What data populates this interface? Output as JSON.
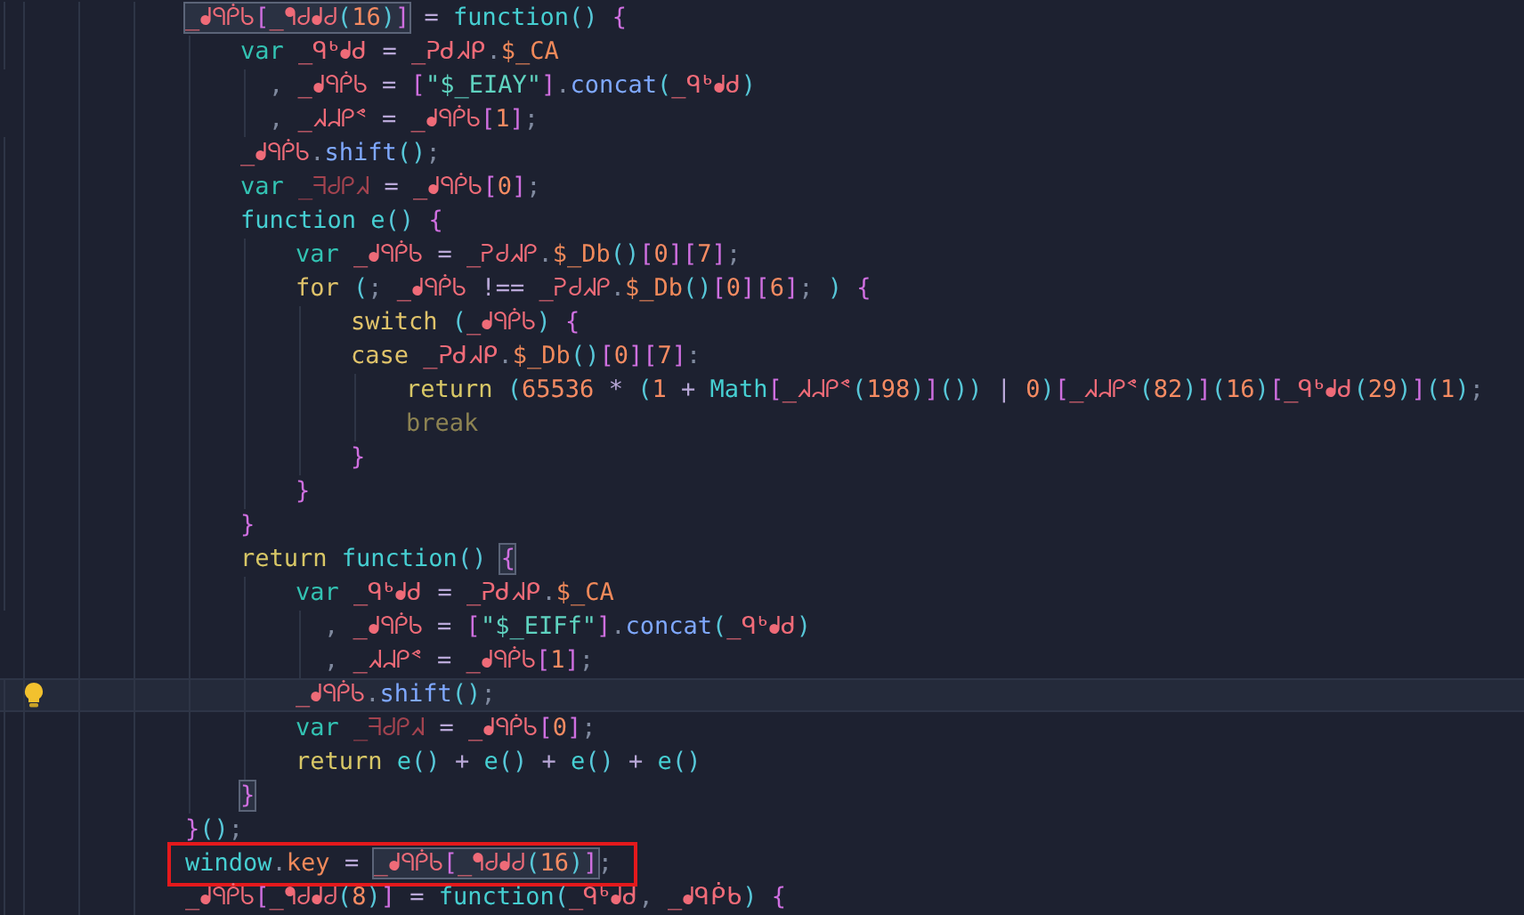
{
  "editor": {
    "lines": [
      {
        "current": false,
        "annotated": false,
        "tokens": [
          {
            "kind": "group",
            "boxed": true,
            "parts": [
              {
                "kind": "i",
                "t": "_ᖱᑫᑮᑲ"
              },
              {
                "kind": "br",
                "t": "["
              },
              {
                "kind": "i",
                "t": "_ᖳᑯᖱᑯ"
              },
              {
                "kind": "pa",
                "t": "("
              },
              {
                "kind": "n",
                "t": "16"
              },
              {
                "kind": "pa",
                "t": ")"
              },
              {
                "kind": "br",
                "t": "]"
              }
            ]
          },
          {
            "kind": "o",
            "t": " = "
          },
          {
            "kind": "f",
            "t": "function"
          },
          {
            "kind": "pa",
            "t": "() "
          },
          {
            "kind": "br",
            "t": "{"
          }
        ],
        "children": [
          {
            "current": false,
            "annotated": false,
            "tokens": [
              {
                "kind": "v",
                "t": "var "
              },
              {
                "kind": "i",
                "t": "_ᑫᒃᖱᑯ"
              },
              {
                "kind": "o",
                "t": " = "
              },
              {
                "kind": "i",
                "t": "_ᕈᑯᖽᑭ"
              },
              {
                "kind": "p",
                "t": "."
              },
              {
                "kind": "pr",
                "t": "$_CA"
              }
            ]
          },
          {
            "kind": "cont",
            "current": false,
            "annotated": false,
            "tokens": [
              {
                "kind": "p",
                "t": ", "
              },
              {
                "kind": "i",
                "t": "_ᖱᑫᑮᑲ"
              },
              {
                "kind": "o",
                "t": " = "
              },
              {
                "kind": "br",
                "t": "["
              },
              {
                "kind": "s",
                "t": "\"$_EIAY\""
              },
              {
                "kind": "br",
                "t": "]"
              },
              {
                "kind": "p",
                "t": "."
              },
              {
                "kind": "m",
                "t": "concat"
              },
              {
                "kind": "pa",
                "t": "("
              },
              {
                "kind": "i",
                "t": "_ᑫᒃᖱᑯ"
              },
              {
                "kind": "pa",
                "t": ")"
              }
            ]
          },
          {
            "kind": "cont",
            "current": false,
            "annotated": false,
            "tokens": [
              {
                "kind": "p",
                "t": ", "
              },
              {
                "kind": "i",
                "t": "_ᖽᖹᑭᕝ"
              },
              {
                "kind": "o",
                "t": " = "
              },
              {
                "kind": "i",
                "t": "_ᖱᑫᑮᑲ"
              },
              {
                "kind": "br",
                "t": "["
              },
              {
                "kind": "n",
                "t": "1"
              },
              {
                "kind": "br",
                "t": "]"
              },
              {
                "kind": "p",
                "t": ";"
              }
            ]
          },
          {
            "current": false,
            "annotated": false,
            "tokens": [
              {
                "kind": "i",
                "t": "_ᖱᑫᑮᑲ"
              },
              {
                "kind": "p",
                "t": "."
              },
              {
                "kind": "m",
                "t": "shift"
              },
              {
                "kind": "pa",
                "t": "()"
              },
              {
                "kind": "p",
                "t": ";"
              }
            ]
          },
          {
            "current": false,
            "annotated": false,
            "tokens": [
              {
                "kind": "v",
                "t": "var "
              },
              {
                "kind": "d",
                "t": "_ᖷᑯᑭᖽ"
              },
              {
                "kind": "o",
                "t": " = "
              },
              {
                "kind": "i",
                "t": "_ᖱᑫᑮᑲ"
              },
              {
                "kind": "br",
                "t": "["
              },
              {
                "kind": "n",
                "t": "0"
              },
              {
                "kind": "br",
                "t": "]"
              },
              {
                "kind": "p",
                "t": ";"
              }
            ]
          },
          {
            "current": false,
            "annotated": false,
            "tokens": [
              {
                "kind": "f",
                "t": "function "
              },
              {
                "kind": "g",
                "t": "e"
              },
              {
                "kind": "pa",
                "t": "() "
              },
              {
                "kind": "br",
                "t": "{"
              }
            ],
            "children": [
              {
                "current": false,
                "annotated": false,
                "tokens": [
                  {
                    "kind": "v",
                    "t": "var "
                  },
                  {
                    "kind": "i",
                    "t": "_ᖱᑫᑮᑲ"
                  },
                  {
                    "kind": "o",
                    "t": " = "
                  },
                  {
                    "kind": "i",
                    "t": "_ᕈᑯᖽᑭ"
                  },
                  {
                    "kind": "p",
                    "t": "."
                  },
                  {
                    "kind": "pr",
                    "t": "$_Db"
                  },
                  {
                    "kind": "pa",
                    "t": "()"
                  },
                  {
                    "kind": "br",
                    "t": "["
                  },
                  {
                    "kind": "n",
                    "t": "0"
                  },
                  {
                    "kind": "br",
                    "t": "]["
                  },
                  {
                    "kind": "n",
                    "t": "7"
                  },
                  {
                    "kind": "br",
                    "t": "]"
                  },
                  {
                    "kind": "p",
                    "t": ";"
                  }
                ]
              },
              {
                "current": false,
                "annotated": false,
                "tokens": [
                  {
                    "kind": "c",
                    "t": "for "
                  },
                  {
                    "kind": "pa",
                    "t": "("
                  },
                  {
                    "kind": "p",
                    "t": "; "
                  },
                  {
                    "kind": "i",
                    "t": "_ᖱᑫᑮᑲ"
                  },
                  {
                    "kind": "o",
                    "t": " !== "
                  },
                  {
                    "kind": "i",
                    "t": "_ᕈᑯᖽᑭ"
                  },
                  {
                    "kind": "p",
                    "t": "."
                  },
                  {
                    "kind": "pr",
                    "t": "$_Db"
                  },
                  {
                    "kind": "pa",
                    "t": "()"
                  },
                  {
                    "kind": "br",
                    "t": "["
                  },
                  {
                    "kind": "n",
                    "t": "0"
                  },
                  {
                    "kind": "br",
                    "t": "]["
                  },
                  {
                    "kind": "n",
                    "t": "6"
                  },
                  {
                    "kind": "br",
                    "t": "]"
                  },
                  {
                    "kind": "p",
                    "t": "; "
                  },
                  {
                    "kind": "pa",
                    "t": ") "
                  },
                  {
                    "kind": "br",
                    "t": "{"
                  }
                ],
                "children": [
                  {
                    "current": false,
                    "annotated": false,
                    "tokens": [
                      {
                        "kind": "c",
                        "t": "switch "
                      },
                      {
                        "kind": "pa",
                        "t": "("
                      },
                      {
                        "kind": "i",
                        "t": "_ᖱᑫᑮᑲ"
                      },
                      {
                        "kind": "pa",
                        "t": ") "
                      },
                      {
                        "kind": "br",
                        "t": "{"
                      }
                    ],
                    "children": [
                      {
                        "kind": "case",
                        "current": false,
                        "annotated": false,
                        "tokens": [
                          {
                            "kind": "c",
                            "t": "case "
                          },
                          {
                            "kind": "i",
                            "t": "_ᕈᑯᖽᑭ"
                          },
                          {
                            "kind": "p",
                            "t": "."
                          },
                          {
                            "kind": "pr",
                            "t": "$_Db"
                          },
                          {
                            "kind": "pa",
                            "t": "()"
                          },
                          {
                            "kind": "br",
                            "t": "["
                          },
                          {
                            "kind": "n",
                            "t": "0"
                          },
                          {
                            "kind": "br",
                            "t": "]["
                          },
                          {
                            "kind": "n",
                            "t": "7"
                          },
                          {
                            "kind": "br",
                            "t": "]"
                          },
                          {
                            "kind": "p",
                            "t": ":"
                          }
                        ],
                        "children": [
                          {
                            "current": false,
                            "annotated": false,
                            "tokens": [
                              {
                                "kind": "r",
                                "t": "return "
                              },
                              {
                                "kind": "pa",
                                "t": "("
                              },
                              {
                                "kind": "n",
                                "t": "65536"
                              },
                              {
                                "kind": "o",
                                "t": " * "
                              },
                              {
                                "kind": "pa",
                                "t": "("
                              },
                              {
                                "kind": "n",
                                "t": "1"
                              },
                              {
                                "kind": "o",
                                "t": " + "
                              },
                              {
                                "kind": "g",
                                "t": "Math"
                              },
                              {
                                "kind": "br",
                                "t": "["
                              },
                              {
                                "kind": "i",
                                "t": "_ᖽᖹᑭᕝ"
                              },
                              {
                                "kind": "pa",
                                "t": "("
                              },
                              {
                                "kind": "n",
                                "t": "198"
                              },
                              {
                                "kind": "pa",
                                "t": ")"
                              },
                              {
                                "kind": "br",
                                "t": "]"
                              },
                              {
                                "kind": "pa",
                                "t": "())"
                              },
                              {
                                "kind": "o",
                                "t": " | "
                              },
                              {
                                "kind": "n",
                                "t": "0"
                              },
                              {
                                "kind": "pa",
                                "t": ")"
                              },
                              {
                                "kind": "br",
                                "t": "["
                              },
                              {
                                "kind": "i",
                                "t": "_ᖽᖹᑭᕝ"
                              },
                              {
                                "kind": "pa",
                                "t": "("
                              },
                              {
                                "kind": "n",
                                "t": "82"
                              },
                              {
                                "kind": "pa",
                                "t": ")"
                              },
                              {
                                "kind": "br",
                                "t": "]"
                              },
                              {
                                "kind": "pa",
                                "t": "("
                              },
                              {
                                "kind": "n",
                                "t": "16"
                              },
                              {
                                "kind": "pa",
                                "t": ")"
                              },
                              {
                                "kind": "br",
                                "t": "["
                              },
                              {
                                "kind": "i",
                                "t": "_ᑫᒃᖱᑯ"
                              },
                              {
                                "kind": "pa",
                                "t": "("
                              },
                              {
                                "kind": "n",
                                "t": "29"
                              },
                              {
                                "kind": "pa",
                                "t": ")"
                              },
                              {
                                "kind": "br",
                                "t": "]"
                              },
                              {
                                "kind": "pa",
                                "t": "("
                              },
                              {
                                "kind": "n",
                                "t": "1"
                              },
                              {
                                "kind": "pa",
                                "t": ")"
                              },
                              {
                                "kind": "p",
                                "t": ";"
                              }
                            ]
                          },
                          {
                            "current": false,
                            "annotated": false,
                            "tokens": [
                              {
                                "kind": "b",
                                "t": "break"
                              }
                            ]
                          }
                        ]
                      }
                    ]
                  },
                  {
                    "current": false,
                    "annotated": false,
                    "tokens": [
                      {
                        "kind": "br",
                        "t": "}"
                      }
                    ]
                  }
                ]
              },
              {
                "current": false,
                "annotated": false,
                "tokens": [
                  {
                    "kind": "br",
                    "t": "}"
                  }
                ]
              }
            ]
          },
          {
            "current": false,
            "annotated": false,
            "tokens": [
              {
                "kind": "br",
                "t": "}"
              }
            ]
          },
          {
            "current": false,
            "annotated": false,
            "tokens": [
              {
                "kind": "r",
                "t": "return "
              },
              {
                "kind": "f",
                "t": "function"
              },
              {
                "kind": "pa",
                "t": "() "
              },
              {
                "kind": "group",
                "boxed": true,
                "parts": [
                  {
                    "kind": "br",
                    "t": "{"
                  }
                ]
              }
            ],
            "children": [
              {
                "current": false,
                "annotated": false,
                "tokens": [
                  {
                    "kind": "v",
                    "t": "var "
                  },
                  {
                    "kind": "i",
                    "t": "_ᑫᒃᖱᑯ"
                  },
                  {
                    "kind": "o",
                    "t": " = "
                  },
                  {
                    "kind": "i",
                    "t": "_ᕈᑯᖽᑭ"
                  },
                  {
                    "kind": "p",
                    "t": "."
                  },
                  {
                    "kind": "pr",
                    "t": "$_CA"
                  }
                ]
              },
              {
                "kind": "cont",
                "current": false,
                "annotated": false,
                "tokens": [
                  {
                    "kind": "p",
                    "t": ", "
                  },
                  {
                    "kind": "i",
                    "t": "_ᖱᑫᑮᑲ"
                  },
                  {
                    "kind": "o",
                    "t": " = "
                  },
                  {
                    "kind": "br",
                    "t": "["
                  },
                  {
                    "kind": "s",
                    "t": "\"$_EIFf\""
                  },
                  {
                    "kind": "br",
                    "t": "]"
                  },
                  {
                    "kind": "p",
                    "t": "."
                  },
                  {
                    "kind": "m",
                    "t": "concat"
                  },
                  {
                    "kind": "pa",
                    "t": "("
                  },
                  {
                    "kind": "i",
                    "t": "_ᑫᒃᖱᑯ"
                  },
                  {
                    "kind": "pa",
                    "t": ")"
                  }
                ]
              },
              {
                "kind": "cont",
                "current": false,
                "annotated": false,
                "tokens": [
                  {
                    "kind": "p",
                    "t": ", "
                  },
                  {
                    "kind": "i",
                    "t": "_ᖽᖹᑭᕝ"
                  },
                  {
                    "kind": "o",
                    "t": " = "
                  },
                  {
                    "kind": "i",
                    "t": "_ᖱᑫᑮᑲ"
                  },
                  {
                    "kind": "br",
                    "t": "["
                  },
                  {
                    "kind": "n",
                    "t": "1"
                  },
                  {
                    "kind": "br",
                    "t": "]"
                  },
                  {
                    "kind": "p",
                    "t": ";"
                  }
                ]
              },
              {
                "current": true,
                "annotated": false,
                "tokens": [
                  {
                    "kind": "i",
                    "t": "_ᖱᑫᑮᑲ"
                  },
                  {
                    "kind": "p",
                    "t": "."
                  },
                  {
                    "kind": "m",
                    "t": "shift"
                  },
                  {
                    "kind": "pa",
                    "t": "()"
                  },
                  {
                    "kind": "p",
                    "t": ";"
                  }
                ]
              },
              {
                "current": false,
                "annotated": false,
                "tokens": [
                  {
                    "kind": "v",
                    "t": "var "
                  },
                  {
                    "kind": "d",
                    "t": "_ᖷᑯᑭᖽ"
                  },
                  {
                    "kind": "o",
                    "t": " = "
                  },
                  {
                    "kind": "i",
                    "t": "_ᖱᑫᑮᑲ"
                  },
                  {
                    "kind": "br",
                    "t": "["
                  },
                  {
                    "kind": "n",
                    "t": "0"
                  },
                  {
                    "kind": "br",
                    "t": "]"
                  },
                  {
                    "kind": "p",
                    "t": ";"
                  }
                ]
              },
              {
                "current": false,
                "annotated": false,
                "tokens": [
                  {
                    "kind": "r",
                    "t": "return "
                  },
                  {
                    "kind": "g",
                    "t": "e"
                  },
                  {
                    "kind": "pa",
                    "t": "()"
                  },
                  {
                    "kind": "o",
                    "t": " + "
                  },
                  {
                    "kind": "g",
                    "t": "e"
                  },
                  {
                    "kind": "pa",
                    "t": "()"
                  },
                  {
                    "kind": "o",
                    "t": " + "
                  },
                  {
                    "kind": "g",
                    "t": "e"
                  },
                  {
                    "kind": "pa",
                    "t": "()"
                  },
                  {
                    "kind": "o",
                    "t": " + "
                  },
                  {
                    "kind": "g",
                    "t": "e"
                  },
                  {
                    "kind": "pa",
                    "t": "()"
                  }
                ]
              }
            ]
          },
          {
            "current": false,
            "annotated": false,
            "tokens": [
              {
                "kind": "group",
                "boxed": true,
                "parts": [
                  {
                    "kind": "br",
                    "t": "}"
                  }
                ]
              }
            ]
          }
        ]
      },
      {
        "current": false,
        "annotated": false,
        "tokens": [
          {
            "kind": "br",
            "t": "}"
          },
          {
            "kind": "pa",
            "t": "()"
          },
          {
            "kind": "p",
            "t": ";"
          }
        ]
      },
      {
        "current": false,
        "annotated": true,
        "tokens": [
          {
            "kind": "g",
            "t": "window"
          },
          {
            "kind": "p",
            "t": "."
          },
          {
            "kind": "pr",
            "t": "key"
          },
          {
            "kind": "o",
            "t": " = "
          },
          {
            "kind": "group",
            "boxed": true,
            "parts": [
              {
                "kind": "i",
                "t": "_ᖱᑫᑮᑲ"
              },
              {
                "kind": "br",
                "t": "["
              },
              {
                "kind": "i",
                "t": "_ᖳᑯᖱᑯ"
              },
              {
                "kind": "pa",
                "t": "("
              },
              {
                "kind": "n",
                "t": "16"
              },
              {
                "kind": "pa",
                "t": ")"
              },
              {
                "kind": "br",
                "t": "]"
              }
            ]
          },
          {
            "kind": "p",
            "t": ";"
          }
        ]
      },
      {
        "current": false,
        "annotated": false,
        "tokens": [
          {
            "kind": "i",
            "t": "_ᖱᑫᑮᑲ"
          },
          {
            "kind": "br",
            "t": "["
          },
          {
            "kind": "i",
            "t": "_ᖳᑯᖱᑯ"
          },
          {
            "kind": "pa",
            "t": "("
          },
          {
            "kind": "n",
            "t": "8"
          },
          {
            "kind": "pa",
            "t": ")"
          },
          {
            "kind": "br",
            "t": "]"
          },
          {
            "kind": "o",
            "t": " = "
          },
          {
            "kind": "f",
            "t": "function"
          },
          {
            "kind": "pa",
            "t": "("
          },
          {
            "kind": "i",
            "t": "_ᑫᒃᖱᑯ"
          },
          {
            "kind": "p",
            "t": ", "
          },
          {
            "kind": "i",
            "t": "_ᖱᑫᑮᑲ"
          },
          {
            "kind": "pa",
            "t": ") "
          },
          {
            "kind": "br",
            "t": "{"
          }
        ]
      }
    ]
  }
}
